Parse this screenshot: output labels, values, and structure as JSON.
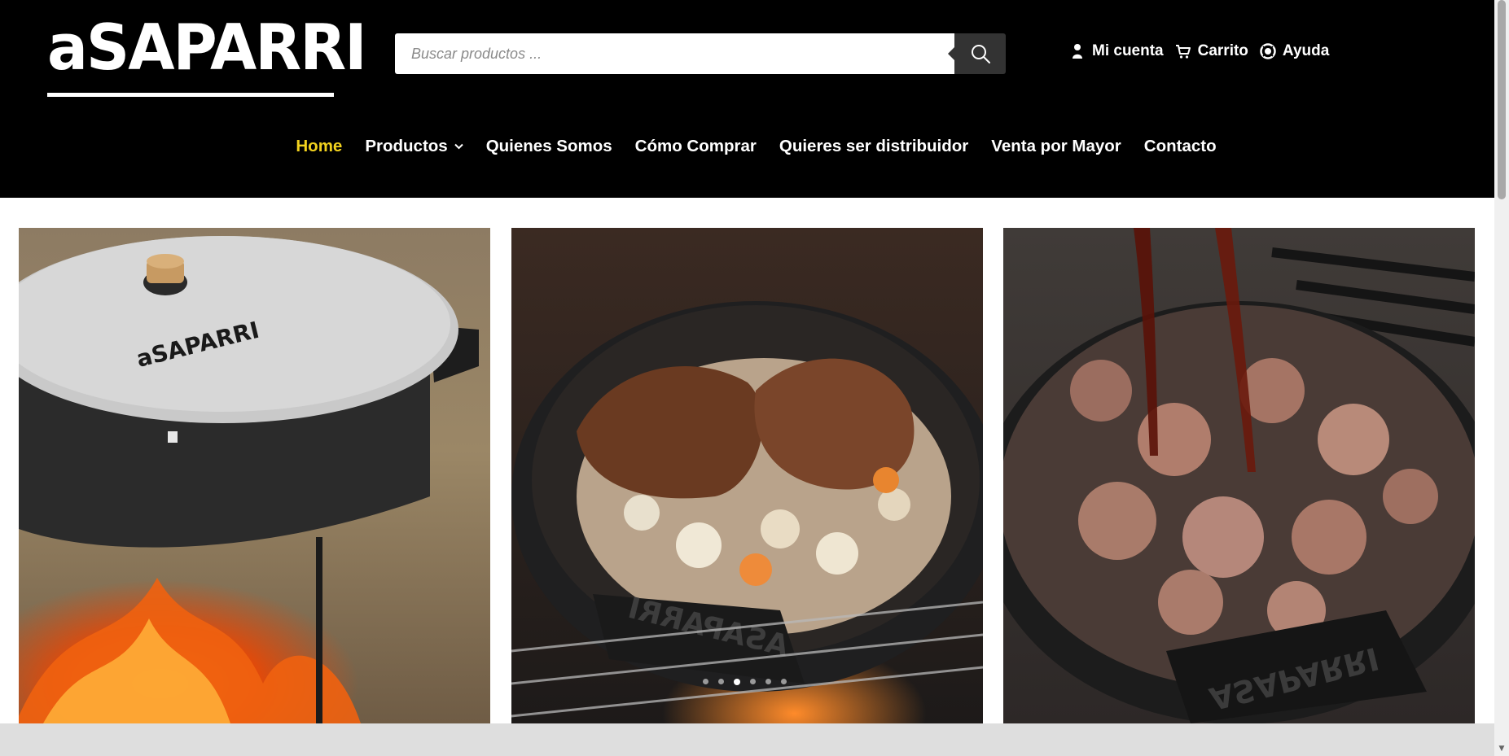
{
  "brand": {
    "logo_text": "aSAPARRI"
  },
  "search": {
    "placeholder": "Buscar productos ...",
    "icon": "search-icon"
  },
  "user_nav": [
    {
      "label": "Mi cuenta",
      "icon": "user-icon"
    },
    {
      "label": "Carrito",
      "icon": "cart-icon"
    },
    {
      "label": "Ayuda",
      "icon": "help-icon"
    }
  ],
  "main_nav": [
    {
      "label": "Home",
      "active": true
    },
    {
      "label": "Productos",
      "has_dropdown": true
    },
    {
      "label": "Quienes Somos"
    },
    {
      "label": "Cómo Comprar"
    },
    {
      "label": "Quieres ser distribuidor"
    },
    {
      "label": "Venta por Mayor"
    },
    {
      "label": "Contacto"
    }
  ],
  "gallery": [
    {
      "name": "Covered pan over open fire",
      "lid_text": "aSAPARRI"
    },
    {
      "name": "Meat and vegetables in pan",
      "pan_text": "ASAPARRI"
    },
    {
      "name": "Sauce poured over meat in pan",
      "pan_text": "ASAPARRI"
    }
  ],
  "carousel": {
    "dots": 6,
    "active_index": 2
  },
  "colors": {
    "header_bg": "#000000",
    "accent": "#f2d21e",
    "search_button": "#333333",
    "bottom_bar": "#dedede"
  }
}
